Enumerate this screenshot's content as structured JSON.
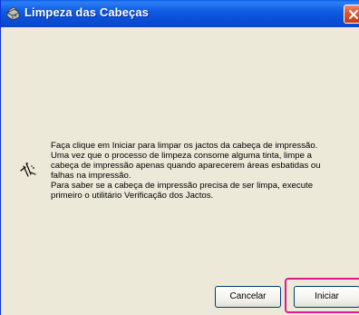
{
  "window": {
    "title": "Limpeza das Cabeças",
    "title_icon": "printer-cleaning-icon",
    "close_icon": "close-icon"
  },
  "message": {
    "icon": "print-head-cleaning-icon",
    "lines": [
      "Faça clique em Iniciar para limpar os jactos da cabeça de impressão.",
      "Uma vez que o processo de limpeza consome alguma tinta, limpe a",
      "cabeça de impressão apenas quando aparecerem áreas esbatidas ou",
      "falhas na impressão.",
      "Para saber se a cabeça de impressão precisa de ser limpa, execute",
      "primeiro o utilitário Verificação dos Jactos."
    ]
  },
  "buttons": {
    "cancel_label": "Cancelar",
    "start_label": "Iniciar"
  },
  "colors": {
    "titlebar": "#0a4fd8",
    "dialog_background": "#ece9d8",
    "highlight": "#e0198c"
  }
}
